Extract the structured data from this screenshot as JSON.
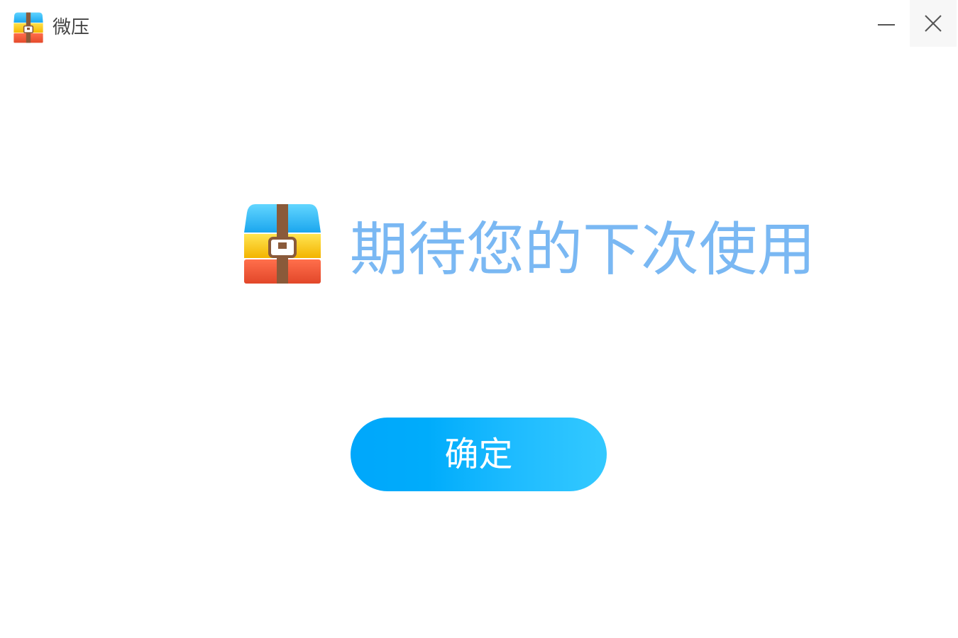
{
  "window": {
    "title": "微压",
    "controls": {
      "minimize_icon": "minimize-icon",
      "close_icon": "close-icon"
    }
  },
  "main": {
    "message": "期待您的下次使用",
    "confirm_label": "确定"
  },
  "icons": {
    "app_icon": "archive-box-icon",
    "hero_icon": "archive-box-icon"
  },
  "colors": {
    "message_text": "#7ab8f3",
    "button_gradient_start": "#00a7fb",
    "button_gradient_end": "#33c9ff",
    "button_text": "#ffffff",
    "title_text": "#444444"
  }
}
